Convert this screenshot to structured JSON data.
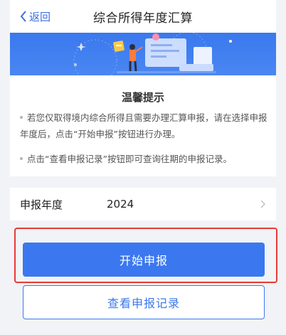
{
  "nav": {
    "back_label": "返回",
    "title": "综合所得年度汇算"
  },
  "tips": {
    "title": "温馨提示",
    "items": [
      "若您仅取得境内综合所得且需要办理汇算申报，请在选择申报年度后，点击“开始申报”按钮进行办理。",
      "点击“查看申报记录”按钮即可查询往期的申报记录。"
    ]
  },
  "year_row": {
    "label": "申报年度",
    "value": "2024"
  },
  "buttons": {
    "start_label": "开始申报",
    "records_label": "查看申报记录"
  },
  "colors": {
    "accent": "#3b78ef",
    "highlight_border": "#e63a36",
    "background": "#f2f3f7"
  }
}
